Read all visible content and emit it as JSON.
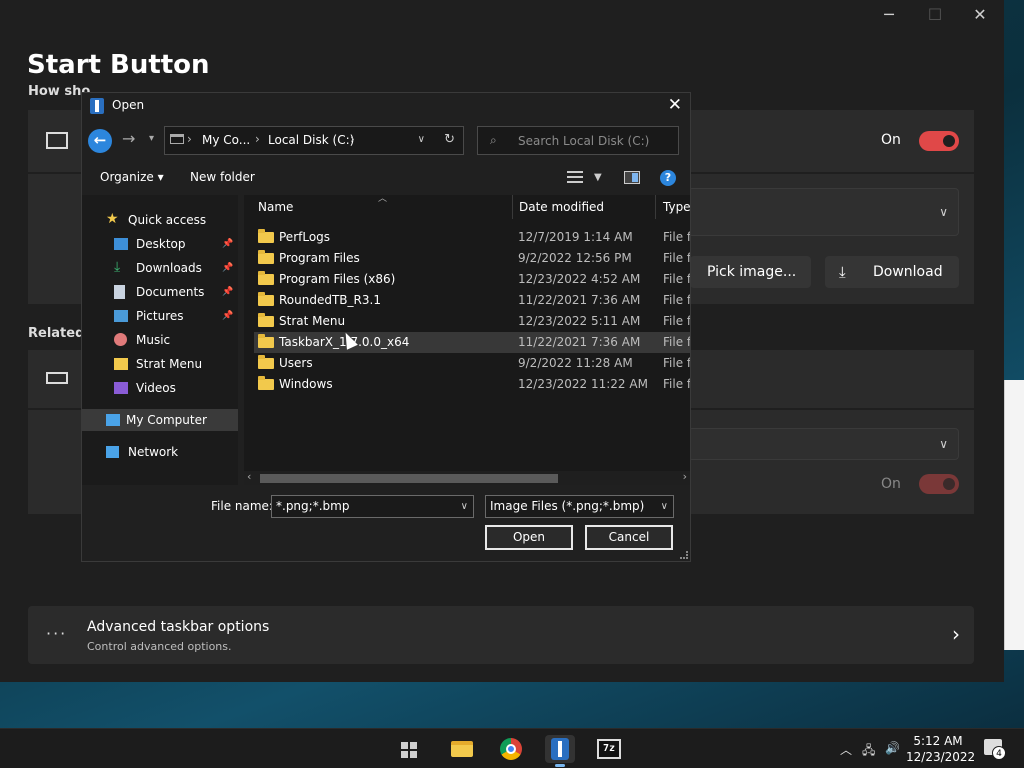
{
  "background": {
    "title": "Start Button",
    "subtitle": "How sho",
    "toggle1_label": "On",
    "toggle2_label": "On",
    "related_label": "Related",
    "pick_image_label": "Pick image...",
    "download_label": "Download",
    "advanced": {
      "title": "Advanced taskbar options",
      "subtitle": "Control advanced options."
    }
  },
  "dialog": {
    "title": "Open",
    "address": {
      "crumb1": "My Co...",
      "crumb2": "Local Disk (C:)"
    },
    "search_placeholder": "Search Local Disk (C:)",
    "toolbar": {
      "organize": "Organize",
      "new_folder": "New folder",
      "help": "?"
    },
    "nav": {
      "quick_access": "Quick access",
      "items": [
        {
          "label": "Desktop"
        },
        {
          "label": "Downloads"
        },
        {
          "label": "Documents"
        },
        {
          "label": "Pictures"
        },
        {
          "label": "Music"
        },
        {
          "label": "Strat Menu"
        },
        {
          "label": "Videos"
        }
      ],
      "my_computer": "My Computer",
      "network": "Network"
    },
    "columns": {
      "name": "Name",
      "date": "Date modified",
      "type": "Type"
    },
    "files": [
      {
        "name": "PerfLogs",
        "date": "12/7/2019 1:14 AM",
        "type": "File fo"
      },
      {
        "name": "Program Files",
        "date": "9/2/2022 12:56 PM",
        "type": "File fo"
      },
      {
        "name": "Program Files (x86)",
        "date": "12/23/2022 4:52 AM",
        "type": "File fo"
      },
      {
        "name": "RoundedTB_R3.1",
        "date": "11/22/2021 7:36 AM",
        "type": "File fo"
      },
      {
        "name": "Strat Menu",
        "date": "12/23/2022 5:11 AM",
        "type": "File fo"
      },
      {
        "name": "TaskbarX_1.7.0.0_x64",
        "date": "11/22/2021 7:36 AM",
        "type": "File fo"
      },
      {
        "name": "Users",
        "date": "9/2/2022 11:28 AM",
        "type": "File fo"
      },
      {
        "name": "Windows",
        "date": "12/23/2022 11:22 AM",
        "type": "File fo"
      }
    ],
    "file_name_label": "File name:",
    "file_name_value": "*.png;*.bmp",
    "file_type_value": "Image Files (*.png;*.bmp)",
    "open_label": "Open",
    "cancel_label": "Cancel"
  },
  "taskbar": {
    "clock_time": "5:12 AM",
    "clock_date": "12/23/2022",
    "notification_count": "4",
    "zip_label": "7z"
  }
}
